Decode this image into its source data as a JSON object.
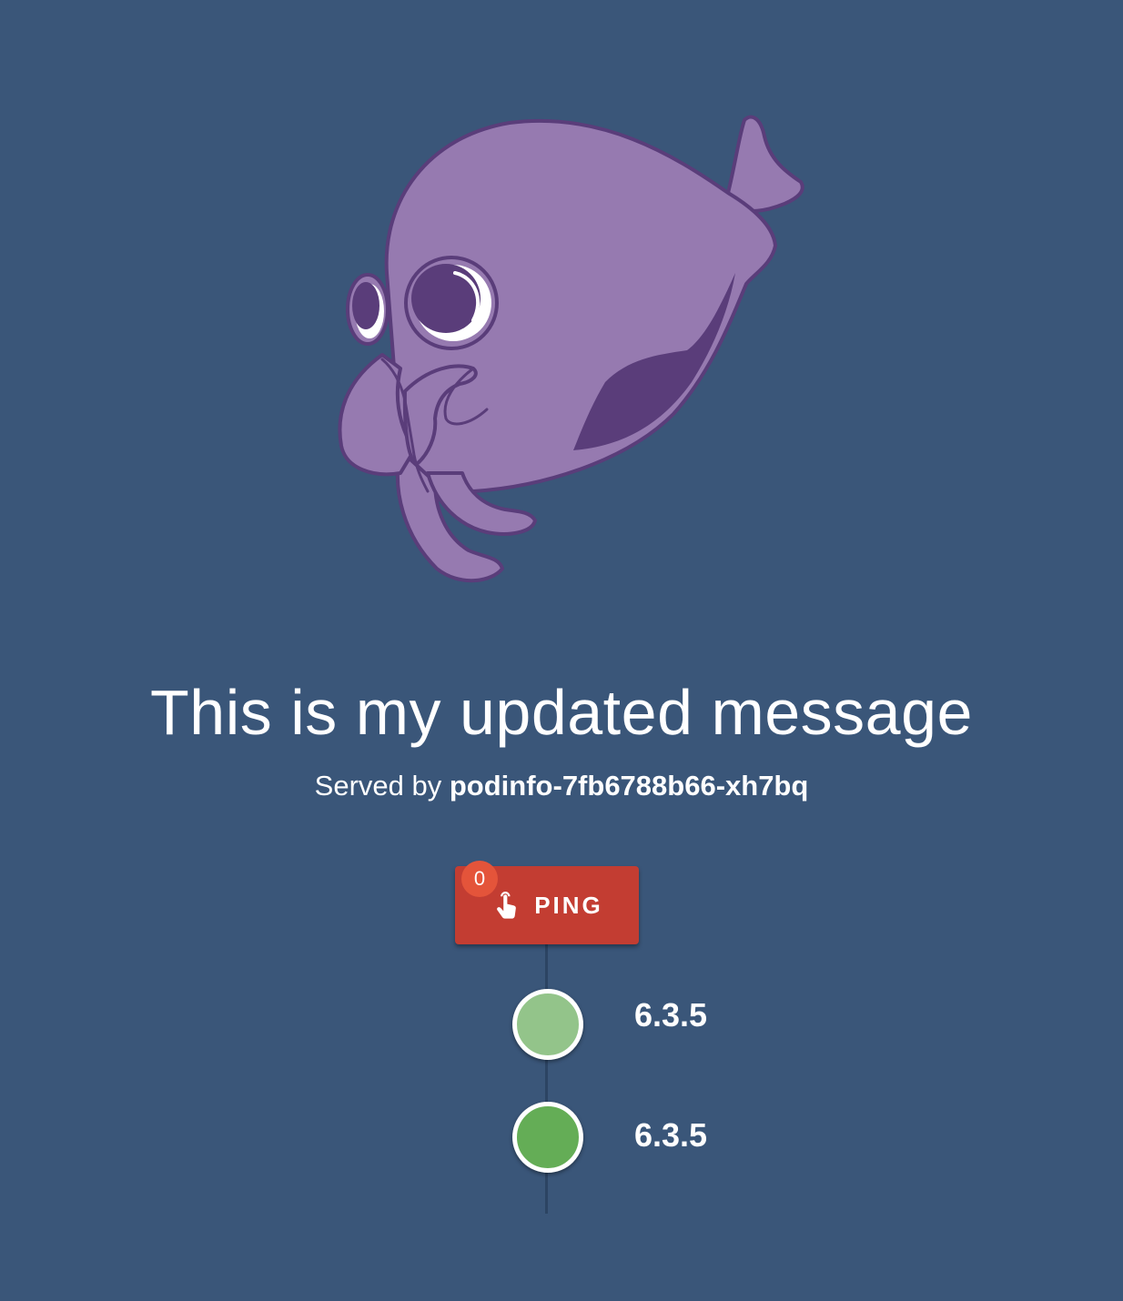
{
  "message": "This is my updated message",
  "served_by": {
    "prefix": "Served by",
    "hostname": "podinfo-7fb6788b66-xh7bq"
  },
  "ping_button": {
    "label": "PING",
    "icon": "hand-pointer-icon",
    "badge_count": "0"
  },
  "timeline": {
    "items": [
      {
        "version": "6.3.5",
        "color": "#93c48a"
      },
      {
        "version": "6.3.5",
        "color": "#64ad56"
      }
    ]
  },
  "colors": {
    "background": "#3a5679",
    "button": "#c33d32",
    "badge": "#e4543a",
    "mascot_body": "#967ab0",
    "mascot_dark": "#5a3d7a"
  }
}
